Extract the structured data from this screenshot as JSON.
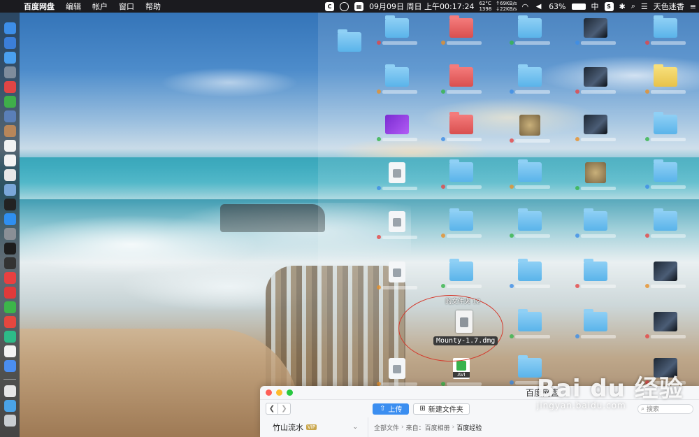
{
  "menubar": {
    "app_name": "百度网盘",
    "menus": [
      "编辑",
      "帐户",
      "窗口",
      "帮助"
    ],
    "datetime": "09月09日 周日 上午00:17:24",
    "cpu_temp": "62°C",
    "fan": "1398",
    "upload_rate": "↑69KB/s",
    "download_rate": "↓22KB/s",
    "battery": "63%",
    "input_method": "中",
    "user": "天色迷香"
  },
  "dock": {
    "icons": [
      {
        "name": "finder-icon",
        "color": "#3d8ee8"
      },
      {
        "name": "safari-icon",
        "color": "#3b7ed9"
      },
      {
        "name": "safari-compass-icon",
        "color": "#4aa0f0"
      },
      {
        "name": "launchpad-icon",
        "color": "#7e8c9c"
      },
      {
        "name": "fantastical-icon",
        "color": "#e04545"
      },
      {
        "name": "android-icon",
        "color": "#3fae4a"
      },
      {
        "name": "preview-icon",
        "color": "#5a7fb8"
      },
      {
        "name": "notebook-icon",
        "color": "#b8865a"
      },
      {
        "name": "calendar-icon",
        "color": "#f2f2f2"
      },
      {
        "name": "notes-icon",
        "color": "#f4f4f4"
      },
      {
        "name": "textedit-icon",
        "color": "#e8e8e8"
      },
      {
        "name": "photos-icon",
        "color": "#79a6d8"
      },
      {
        "name": "terminal-icon",
        "color": "#222"
      },
      {
        "name": "appstore-icon",
        "color": "#2f8ff0"
      },
      {
        "name": "system-preferences-icon",
        "color": "#8a8f96"
      },
      {
        "name": "activity-monitor-icon",
        "color": "#1d1d1d"
      },
      {
        "name": "console-icon",
        "color": "#333"
      },
      {
        "name": "vivaldi-icon",
        "color": "#e94040"
      },
      {
        "name": "yandex-icon",
        "color": "#e23a3a"
      },
      {
        "name": "wechat-icon",
        "color": "#3cb54a"
      },
      {
        "name": "weibo-icon",
        "color": "#e5473f"
      },
      {
        "name": "coda-icon",
        "color": "#2dbb88"
      },
      {
        "name": "pages-icon",
        "color": "#f3f3f3"
      },
      {
        "name": "baidu-netdisk-icon",
        "color": "#4b8ef0"
      }
    ],
    "trailing": [
      {
        "name": "document-icon",
        "color": "#e6e6e6"
      },
      {
        "name": "downloads-folder-icon",
        "color": "#4aa3e8"
      },
      {
        "name": "trash-icon",
        "color": "#c9cdd1"
      }
    ]
  },
  "desktop": {
    "left_caption": "",
    "dmg_top_label": "的文件夹 12",
    "dmg_file_label": "Mounty-1.7.dmg"
  },
  "baidu_window": {
    "title": "百度网盘",
    "upload_label": "上传",
    "new_folder_label": "新建文件夹",
    "search_placeholder": "搜索",
    "account_name": "竹山流水",
    "vip_label": "VIP",
    "breadcrumb": {
      "all_files": "全部文件",
      "from": "来自：百度相册",
      "current": "百度经验"
    }
  },
  "watermark": {
    "logo": "Bai du 经验",
    "url": "jingyan.baidu.com"
  },
  "colors": {
    "accent_blue": "#3b8ef0",
    "highlight_red": "#d4382b",
    "menubar_bg": "#1b1b1f"
  }
}
